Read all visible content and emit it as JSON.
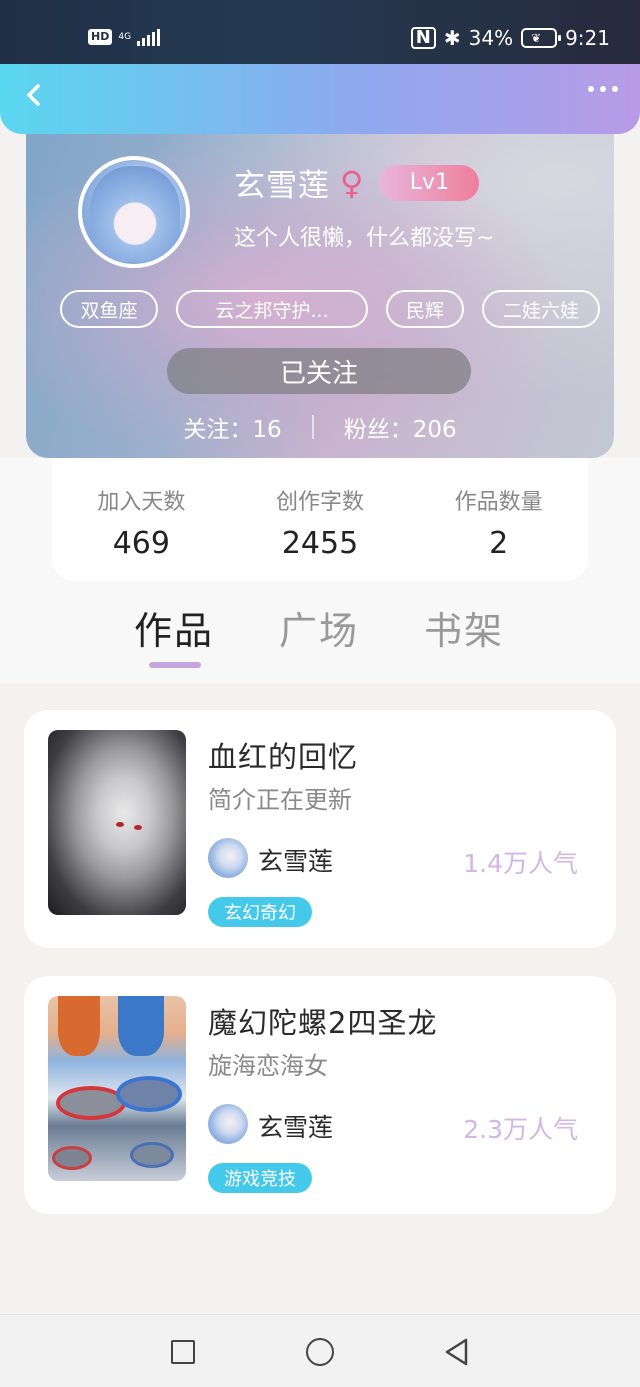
{
  "status_bar": {
    "hd_label": "HD",
    "network_label": "4G",
    "battery_percent": "34%",
    "time": "9:21"
  },
  "header": {
    "back_icon": "chevron-left-icon",
    "more_icon": "more-dots-icon"
  },
  "profile": {
    "username": "玄雪莲",
    "gender_symbol": "♀",
    "level": "Lv1",
    "bio": "这个人很懒，什么都没写~",
    "tags": [
      "双鱼座",
      "云之邦守护...",
      "民辉",
      "二娃六娃"
    ],
    "follow_button": "已关注",
    "following_text": "关注：16",
    "followers_text": "粉丝：206"
  },
  "stats": [
    {
      "label": "加入天数",
      "value": "469"
    },
    {
      "label": "创作字数",
      "value": "2455"
    },
    {
      "label": "作品数量",
      "value": "2"
    }
  ],
  "tabs": [
    {
      "label": "作品",
      "active": true
    },
    {
      "label": "广场",
      "active": false
    },
    {
      "label": "书架",
      "active": false
    }
  ],
  "works": [
    {
      "title": "血红的回忆",
      "description": "简介正在更新",
      "author": "玄雪莲",
      "popularity": "1.4万人气",
      "genre": "玄幻奇幻"
    },
    {
      "title": "魔幻陀螺2四圣龙",
      "description": "旋海恋海女",
      "author": "玄雪莲",
      "popularity": "2.3万人气",
      "genre": "游戏竞技"
    }
  ],
  "colors": {
    "header_gradient_start": "#5ad7f0",
    "header_gradient_end": "#b89be7",
    "level_badge": "#ee7e9c",
    "gender_icon": "#ec5f8c",
    "tab_indicator": "#c7a6e0",
    "popularity": "#d3b6e6",
    "genre_tag": "#45c9ea"
  },
  "nav": {
    "recent_icon": "square-icon",
    "home_icon": "circle-icon",
    "back_icon": "triangle-back-icon"
  }
}
